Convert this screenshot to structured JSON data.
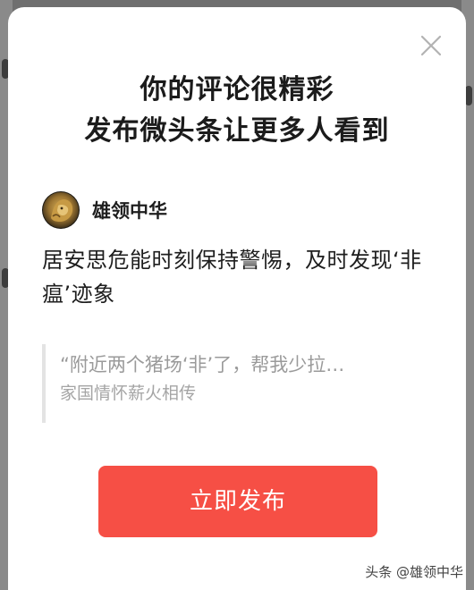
{
  "modal": {
    "headline": {
      "line1": "你的评论很精彩",
      "line2": "发布微头条让更多人看到"
    },
    "author": {
      "name": "雄领中华"
    },
    "comment_text": "居安思危能时刻保持警惕，及时发现‘非瘟’迹象",
    "quote": {
      "text": "“附近两个猪场‘非’了，帮我少拉…",
      "source": "家国情怀薪火相传"
    },
    "publish_label": "立即发布"
  },
  "watermark": "头条 @雄领中华",
  "colors": {
    "accent": "#f64f45",
    "overlay": "#6f6f6f",
    "text_primary": "#1e1e1e",
    "text_muted": "#9a9a9a"
  },
  "icons": {
    "close": "close-icon",
    "avatar": "golden-lion-avatar"
  }
}
